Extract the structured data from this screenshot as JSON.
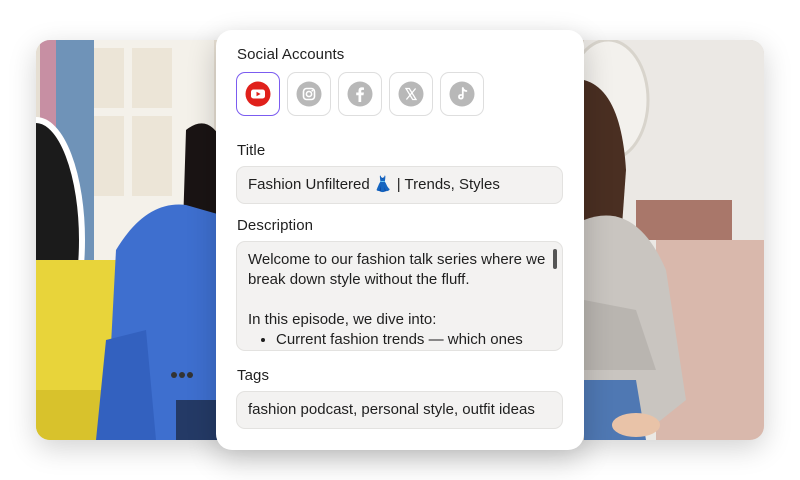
{
  "social": {
    "label": "Social Accounts",
    "accounts": [
      {
        "name": "youtube",
        "icon": "youtube-icon",
        "selected": true,
        "color": "#e0201b"
      },
      {
        "name": "instagram",
        "icon": "instagram-icon",
        "selected": false,
        "color": "#b8b8b8"
      },
      {
        "name": "facebook",
        "icon": "facebook-icon",
        "selected": false,
        "color": "#b8b8b8"
      },
      {
        "name": "x",
        "icon": "x-icon",
        "selected": false,
        "color": "#b8b8b8"
      },
      {
        "name": "tiktok",
        "icon": "tiktok-icon",
        "selected": false,
        "color": "#b8b8b8"
      }
    ],
    "selected_border_color": "#7b5cf0"
  },
  "title": {
    "label": "Title",
    "value": "Fashion Unfiltered 👗 | Trends, Styles"
  },
  "description": {
    "label": "Description",
    "paragraph1": "Welcome to our fashion talk series where we break down style without the fluff.",
    "paragraph2": "In this episode, we dive into:",
    "bullets": [
      "Current fashion trends — which ones"
    ]
  },
  "tags": {
    "label": "Tags",
    "value": "fashion podcast, personal style, outfit ideas"
  }
}
